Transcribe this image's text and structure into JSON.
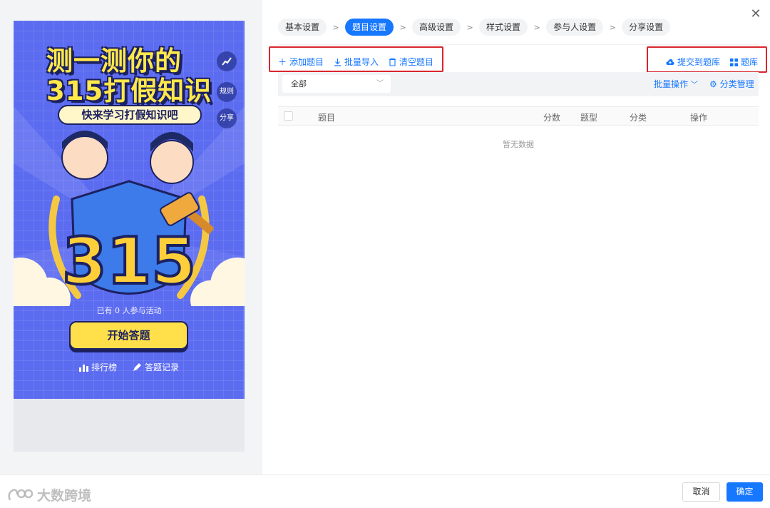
{
  "preview": {
    "title_line1": "测一测你的",
    "title_line2": "315打假知识",
    "subtitle": "快来学习打假知识吧",
    "side_buttons": {
      "rules": "规则",
      "share": "分享"
    },
    "shield_number": "315",
    "participants": "已有 0 人参与活动",
    "start_button": "开始答题",
    "leaderboard": "排行榜",
    "answer_record": "答题记录"
  },
  "steps": [
    {
      "label": "基本设置",
      "active": false
    },
    {
      "label": "题目设置",
      "active": true
    },
    {
      "label": "高级设置",
      "active": false
    },
    {
      "label": "样式设置",
      "active": false
    },
    {
      "label": "参与人设置",
      "active": false
    },
    {
      "label": "分享设置",
      "active": false
    }
  ],
  "toolbar": {
    "add_question": "添加题目",
    "batch_import": "批量导入",
    "clear_questions": "清空题目",
    "submit_to_bank": "提交到题库",
    "question_bank": "题库"
  },
  "filter": {
    "category_selected": "全部",
    "batch_ops": "批量操作",
    "category_manage": "分类管理"
  },
  "table": {
    "columns": [
      "题目",
      "分数",
      "题型",
      "分类",
      "操作"
    ],
    "rows": [],
    "empty_text": "暂无数据"
  },
  "footer": {
    "cancel": "取消",
    "confirm": "确定"
  },
  "watermark": "大数跨境",
  "colors": {
    "primary": "#1677ff",
    "highlight": "#d9262e",
    "poster_bg": "#5c6cf0",
    "poster_yellow": "#ffe84a"
  }
}
